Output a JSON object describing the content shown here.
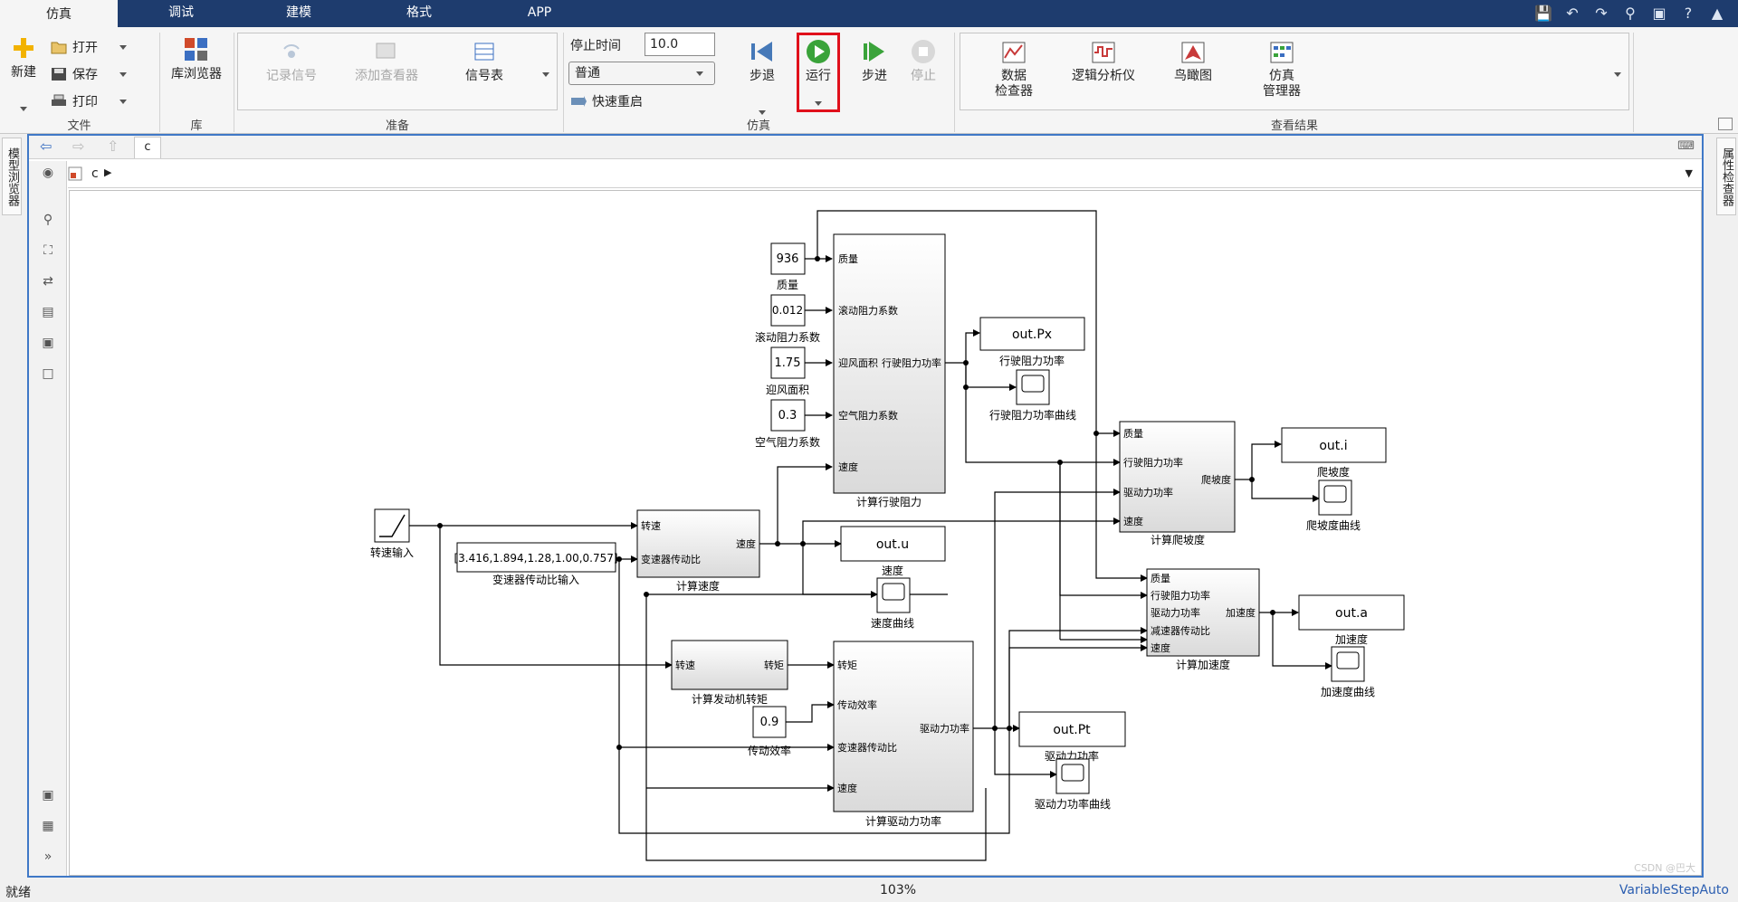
{
  "tabs": [
    "仿真",
    "调试",
    "建模",
    "格式",
    "APP"
  ],
  "ribbon": {
    "file": {
      "new": "新建",
      "open": "打开",
      "save": "保存",
      "print": "打印",
      "label": "文件"
    },
    "library": {
      "browser": "库浏览器",
      "label": "库"
    },
    "prepare": {
      "record": "记录信号",
      "add_viewer": "添加查看器",
      "signal_table": "信号表",
      "label": "准备"
    },
    "simulate": {
      "stop_time_label": "停止时间",
      "stop_time_value": "10.0",
      "mode": "普通",
      "fast_restart": "快速重启",
      "step_back": "步退",
      "run": "运行",
      "step_forward": "步进",
      "stop": "停止",
      "label": "仿真"
    },
    "results": {
      "data_inspector_1": "数据",
      "data_inspector_2": "检查器",
      "logic_analyzer": "逻辑分析仪",
      "birds_eye": "鸟瞰图",
      "sim_manager_1": "仿真",
      "sim_manager_2": "管理器",
      "label": "查看结果"
    }
  },
  "side": {
    "model_browser": "模型浏览器",
    "property_inspector": "属性检查器"
  },
  "nav": {
    "model_tab": "c",
    "breadcrumb": "c"
  },
  "diagram": {
    "const_mass": "936",
    "mass_label": "质量",
    "const_roll": "0.012",
    "roll_label": "滚动阻力系数",
    "const_area": "1.75",
    "area_label": "迎风面积",
    "const_air": "0.3",
    "air_label": "空气阻力系数",
    "resist_block_label": "计算行驶阻力",
    "resist_in1": "质量",
    "resist_in2": "滚动阻力系数",
    "resist_in3": "迎风面积",
    "resist_in4": "空气阻力系数",
    "resist_in5": "速度",
    "resist_out": "行驶阻力功率",
    "out_px": "out.Px",
    "out_px_label": "行驶阻力功率",
    "scope_px_label": "行驶阻力功率曲线",
    "ramp_label": "转速输入",
    "gear_const": "[3.416,1.894,1.28,1.00,0.757]",
    "gear_label": "变速器传动比输入",
    "speed_block_label": "计算速度",
    "speed_in1": "转速",
    "speed_in2": "变速器传动比",
    "speed_out": "速度",
    "out_u": "out.u",
    "out_u_label": "速度",
    "scope_u_label": "速度曲线",
    "torque_block_label": "计算发动机转矩",
    "torque_in": "转速",
    "torque_out": "转矩",
    "const_eff": "0.9",
    "eff_label": "传动效率",
    "drive_block_label": "计算驱动力功率",
    "drive_in1": "转矩",
    "drive_in2": "传动效率",
    "drive_in3": "变速器传动比",
    "drive_in4": "速度",
    "drive_out": "驱动力功率",
    "out_pt": "out.Pt",
    "out_pt_label": "驱动力功率",
    "scope_pt_label": "驱动力功率曲线",
    "grade_block_label": "计算爬坡度",
    "grade_in1": "质量",
    "grade_in2": "行驶阻力功率",
    "grade_in3": "驱动力功率",
    "grade_in4": "速度",
    "grade_out": "爬坡度",
    "out_i": "out.i",
    "out_i_label": "爬坡度",
    "scope_i_label": "爬坡度曲线",
    "accel_block_label": "计算加速度",
    "accel_in1": "质量",
    "accel_in2": "行驶阻力功率",
    "accel_in3": "驱动力功率",
    "accel_in4": "减速器传动比",
    "accel_in5": "速度",
    "accel_out": "加速度",
    "out_a": "out.a",
    "out_a_label": "加速度",
    "scope_a_label": "加速度曲线"
  },
  "status": {
    "left": "就绪",
    "zoom": "103%",
    "solver": "VariableStepAuto",
    "watermark": "CSDN @巴大"
  }
}
